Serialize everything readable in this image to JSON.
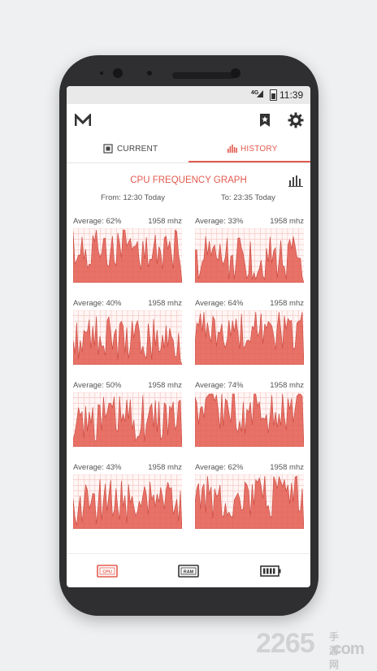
{
  "status": {
    "network": "4G",
    "time": "11:39"
  },
  "app": {
    "logo_text": "M",
    "logo_icon": "m-logo-icon"
  },
  "toolbar": {
    "bookmark_icon": "bookmark-star-icon",
    "settings_icon": "gear-icon"
  },
  "tabs": [
    {
      "label": "CURRENT",
      "icon": "chip-icon",
      "active": false
    },
    {
      "label": "HISTORY",
      "icon": "bar-chart-icon",
      "active": true
    }
  ],
  "accent_color": "#e35a4f",
  "graph": {
    "title": "CPU FREQUENCY GRAPH",
    "from": "From: 12:30 Today",
    "to": "To: 23:35 Today"
  },
  "cores": [
    {
      "average": "Average: 62%",
      "freq": "1958 mhz"
    },
    {
      "average": "Average: 33%",
      "freq": "1958 mhz"
    },
    {
      "average": "Average: 40%",
      "freq": "1958 mhz"
    },
    {
      "average": "Average: 64%",
      "freq": "1958 mhz"
    },
    {
      "average": "Average: 50%",
      "freq": "1958 mhz"
    },
    {
      "average": "Average: 74%",
      "freq": "1958 mhz"
    },
    {
      "average": "Average: 43%",
      "freq": "1958 mhz"
    },
    {
      "average": "Average: 62%",
      "freq": "1958 mhz"
    }
  ],
  "bottom_nav": [
    {
      "label": "CPU",
      "icon": "cpu-icon",
      "active": true
    },
    {
      "label": "RAM",
      "icon": "ram-icon",
      "active": false
    },
    {
      "label": "",
      "icon": "battery-icon",
      "active": false
    }
  ],
  "watermark": {
    "main": "2265",
    "top": "手游网",
    "bottom": ".com"
  }
}
